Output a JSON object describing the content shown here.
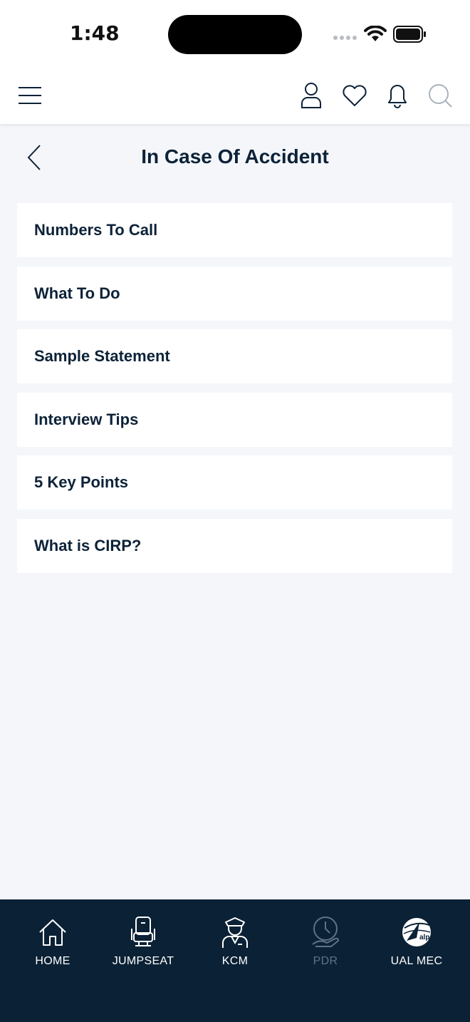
{
  "status_bar": {
    "time": "1:48"
  },
  "page": {
    "title": "In Case Of Accident"
  },
  "menu": {
    "items": [
      {
        "label": "Numbers To Call"
      },
      {
        "label": "What To Do"
      },
      {
        "label": "Sample Statement"
      },
      {
        "label": "Interview Tips"
      },
      {
        "label": "5 Key Points"
      },
      {
        "label": "What is CIRP?"
      }
    ]
  },
  "tabs": [
    {
      "label": "HOME",
      "icon": "home-icon"
    },
    {
      "label": "JUMPSEAT",
      "icon": "seat-icon"
    },
    {
      "label": "KCM",
      "icon": "pilot-icon"
    },
    {
      "label": "PDR",
      "icon": "clock-hand-icon"
    },
    {
      "label": "UAL MEC",
      "icon": "alpa-logo-icon"
    }
  ],
  "alpa_logo_text": "alpa",
  "colors": {
    "navy": "#0b2135",
    "text": "#0c2238",
    "background": "#f4f6fa",
    "disabled": "#5f7386"
  }
}
